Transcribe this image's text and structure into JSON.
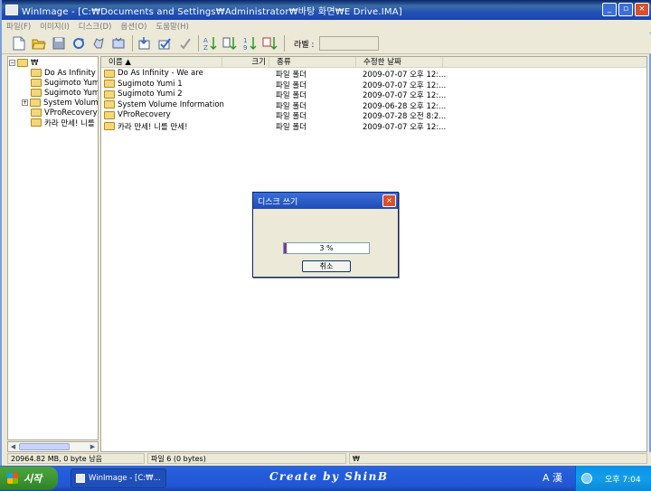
{
  "window": {
    "title": "WinImage - [C:₩Documents and Settings₩Administrator₩바탕 화면₩E Drive.IMA]",
    "caption_buttons": [
      "_",
      "▫",
      "×"
    ]
  },
  "menu": [
    "파일(F)",
    "이미지(I)",
    "디스크(D)",
    "옵션(O)",
    "도움말(H)"
  ],
  "toolbar": {
    "label": "라벨 :",
    "label_value": ""
  },
  "tree": {
    "root": "₩",
    "items": [
      {
        "label": "Do As Infinity - We are",
        "expandable": false
      },
      {
        "label": "Sugimoto Yumi 1",
        "expandable": false
      },
      {
        "label": "Sugimoto Yumi 2",
        "expandable": false
      },
      {
        "label": "System Volume Information",
        "expandable": true
      },
      {
        "label": "VProRecovery",
        "expandable": false
      },
      {
        "label": "카라 만세! 니를 만세!",
        "expandable": false
      }
    ]
  },
  "filelist": {
    "columns": [
      "이름 ▲",
      "크기",
      "종류",
      "수정한 날짜"
    ],
    "rows": [
      {
        "name": "Do As Infinity - We are",
        "size": "",
        "type": "파일 폴더",
        "date": "2009-07-07  오후 12:..."
      },
      {
        "name": "Sugimoto Yumi 1",
        "size": "",
        "type": "파일 폴더",
        "date": "2009-07-07  오후 12:..."
      },
      {
        "name": "Sugimoto Yumi 2",
        "size": "",
        "type": "파일 폴더",
        "date": "2009-07-07  오후 12:..."
      },
      {
        "name": "System Volume Information",
        "size": "",
        "type": "파일 폴더",
        "date": "2009-06-28  오후 12:..."
      },
      {
        "name": "VProRecovery",
        "size": "",
        "type": "파일 폴더",
        "date": "2009-07-28  오전 8:2..."
      },
      {
        "name": "카라 만세! 니를 만세!",
        "size": "",
        "type": "파일 폴더",
        "date": "2009-07-07  오후 12:..."
      }
    ]
  },
  "dialog": {
    "title": "디스크 쓰기",
    "progress_percent": 3,
    "progress_text": "3 %",
    "cancel_label": "취소",
    "close_glyph": "×"
  },
  "status": {
    "free": "20964.82 MB, 0 byte 남음",
    "files": "파일 6 (0 bytes)",
    "path": "₩"
  },
  "taskbar": {
    "start_label": "시작",
    "task_title": "WinImage - [C:₩...",
    "watermark": "Create by ShinB",
    "ime": "A 漢",
    "clock": "오후 7:04"
  },
  "colors": {
    "titlebar": "#2353b7",
    "progress_fill": "#7a3c8a",
    "start_button": "#3c9332",
    "tray": "#139ee9"
  }
}
